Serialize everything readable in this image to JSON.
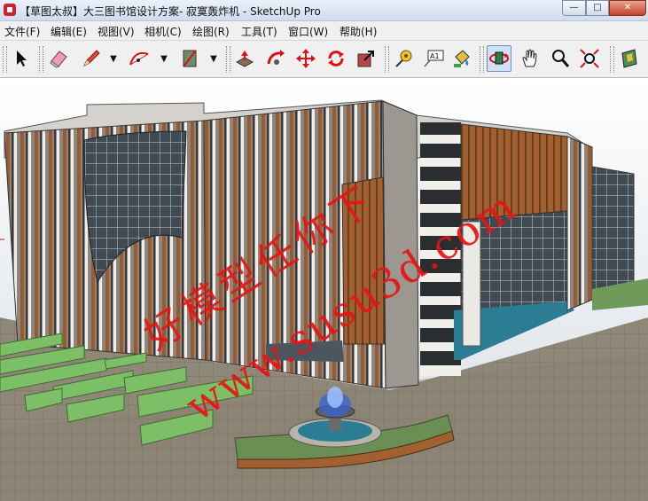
{
  "window": {
    "title": "【草图太叔】大三图书馆设计方案- 寂寞轰炸机 - SketchUp Pro",
    "minimize_glyph": "—",
    "maximize_glyph": "□",
    "close_glyph": "✕"
  },
  "menu": {
    "items": [
      {
        "label": "文件(F)"
      },
      {
        "label": "编辑(E)"
      },
      {
        "label": "视图(V)"
      },
      {
        "label": "相机(C)"
      },
      {
        "label": "绘图(R)"
      },
      {
        "label": "工具(T)"
      },
      {
        "label": "窗口(W)"
      },
      {
        "label": "帮助(H)"
      }
    ]
  },
  "toolbar": {
    "tools": [
      {
        "icon": "select-arrow-icon"
      },
      {
        "icon": "eraser-icon"
      },
      {
        "icon": "pencil-icon"
      },
      {
        "icon": "arc-icon"
      },
      {
        "icon": "rectangle-icon"
      },
      {
        "icon": "push-pull-icon"
      },
      {
        "icon": "follow-me-icon"
      },
      {
        "icon": "move-icon"
      },
      {
        "icon": "rotate-icon"
      },
      {
        "icon": "scale-icon"
      },
      {
        "icon": "tape-measure-icon"
      },
      {
        "icon": "text-label-icon"
      },
      {
        "icon": "paint-bucket-icon"
      },
      {
        "icon": "orbit-icon"
      },
      {
        "icon": "pan-hand-icon"
      },
      {
        "icon": "zoom-icon"
      },
      {
        "icon": "zoom-extents-icon"
      },
      {
        "icon": "section-plane-icon"
      }
    ],
    "text_tool_label": "A1",
    "dropdown_glyph": "▼"
  },
  "colors": {
    "facade": "#a9a29a",
    "wood": "#a0602f",
    "glass": "#3f4a53",
    "hedge": "#7cbf67",
    "plaza": "#8f8878",
    "water": "#2b7d93",
    "watermark": "#e61414"
  },
  "watermark": {
    "line1": "好模型任你下",
    "line2": "www.susu3d.com"
  }
}
